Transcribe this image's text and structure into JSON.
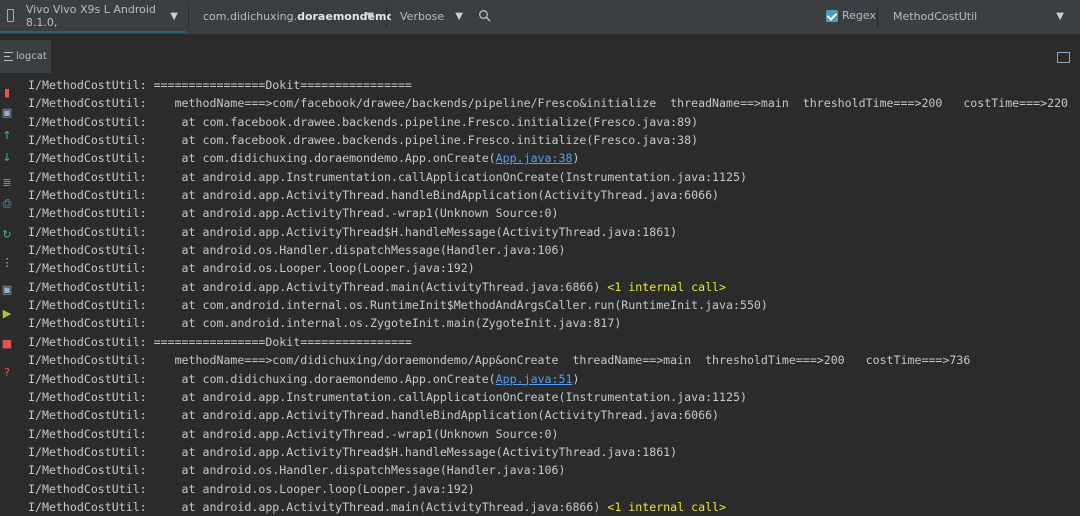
{
  "toolbar": {
    "device": "Vivo Vivo X9s L Android 8.1.0,",
    "package_prefix": "com.didichuxing.",
    "package_bold": "doraemondemo",
    "log_level": "Verbose",
    "regex_label": "Regex",
    "filter_value": "MethodCostUtil"
  },
  "tab": {
    "label": "logcat"
  },
  "log": {
    "lines": [
      {
        "text": "I/MethodCostUtil: ================Dokit================"
      },
      {
        "text": "I/MethodCostUtil:    methodName===>com/facebook/drawee/backends/pipeline/Fresco&initialize  threadName==>main  thresholdTime===>200   costTime===>220"
      },
      {
        "text": "I/MethodCostUtil:     at com.facebook.drawee.backends.pipeline.Fresco.initialize(Fresco.java:89)"
      },
      {
        "text": "I/MethodCostUtil:     at com.facebook.drawee.backends.pipeline.Fresco.initialize(Fresco.java:38)"
      },
      {
        "text": "I/MethodCostUtil:     at com.didichuxing.doraemondemo.App.onCreate(",
        "link": "App.java:38",
        "after": ")"
      },
      {
        "text": "I/MethodCostUtil:     at android.app.Instrumentation.callApplicationOnCreate(Instrumentation.java:1125)"
      },
      {
        "text": "I/MethodCostUtil:     at android.app.ActivityThread.handleBindApplication(ActivityThread.java:6066)"
      },
      {
        "text": "I/MethodCostUtil:     at android.app.ActivityThread.-wrap1(Unknown Source:0)"
      },
      {
        "text": "I/MethodCostUtil:     at android.app.ActivityThread$H.handleMessage(ActivityThread.java:1861)"
      },
      {
        "text": "I/MethodCostUtil:     at android.os.Handler.dispatchMessage(Handler.java:106)"
      },
      {
        "text": "I/MethodCostUtil:     at android.os.Looper.loop(Looper.java:192)"
      },
      {
        "text": "I/MethodCostUtil:     at android.app.ActivityThread.main(ActivityThread.java:6866) ",
        "internal": "<1 internal call>"
      },
      {
        "text": "I/MethodCostUtil:     at com.android.internal.os.RuntimeInit$MethodAndArgsCaller.run(RuntimeInit.java:550)"
      },
      {
        "text": "I/MethodCostUtil:     at com.android.internal.os.ZygoteInit.main(ZygoteInit.java:817)"
      },
      {
        "text": "I/MethodCostUtil: ================Dokit================"
      },
      {
        "text": "I/MethodCostUtil:    methodName===>com/didichuxing/doraemondemo/App&onCreate  threadName==>main  thresholdTime===>200   costTime===>736"
      },
      {
        "text": "I/MethodCostUtil:     at com.didichuxing.doraemondemo.App.onCreate(",
        "link": "App.java:51",
        "after": ")"
      },
      {
        "text": "I/MethodCostUtil:     at android.app.Instrumentation.callApplicationOnCreate(Instrumentation.java:1125)"
      },
      {
        "text": "I/MethodCostUtil:     at android.app.ActivityThread.handleBindApplication(ActivityThread.java:6066)"
      },
      {
        "text": "I/MethodCostUtil:     at android.app.ActivityThread.-wrap1(Unknown Source:0)"
      },
      {
        "text": "I/MethodCostUtil:     at android.app.ActivityThread$H.handleMessage(ActivityThread.java:1861)"
      },
      {
        "text": "I/MethodCostUtil:     at android.os.Handler.dispatchMessage(Handler.java:106)"
      },
      {
        "text": "I/MethodCostUtil:     at android.os.Looper.loop(Looper.java:192)"
      },
      {
        "text": "I/MethodCostUtil:     at android.app.ActivityThread.main(ActivityThread.java:6866) ",
        "internal": "<1 internal call>"
      }
    ]
  },
  "gutter_icons": [
    {
      "name": "clear-logcat-icon",
      "glyph": "▮",
      "color": "#e05555"
    },
    {
      "name": "scroll-to-end-icon",
      "glyph": "▣",
      "color": "#9ab0c8"
    },
    {
      "name": "up-arrow-icon",
      "glyph": "↑",
      "color": "#3fb6a8"
    },
    {
      "name": "down-arrow-icon",
      "glyph": "↓",
      "color": "#3fb6a8"
    },
    {
      "name": "soft-wrap-icon",
      "glyph": "≣",
      "color": "#5a9ee8"
    },
    {
      "name": "print-icon",
      "glyph": "⎙",
      "color": "#5ab0e8"
    },
    {
      "name": "restart-icon",
      "glyph": "↻",
      "color": "#3fb6a8"
    },
    {
      "name": "more-icon",
      "glyph": "⋮",
      "color": "#cccccc"
    },
    {
      "name": "screenshot-icon",
      "glyph": "▣",
      "color": "#9ab0c8"
    },
    {
      "name": "screen-record-icon",
      "glyph": "▶",
      "color": "#a8c83a"
    },
    {
      "name": "stop-icon",
      "glyph": "■",
      "color": "#e05555"
    },
    {
      "name": "help-icon",
      "glyph": "?",
      "color": "#e05555"
    }
  ]
}
